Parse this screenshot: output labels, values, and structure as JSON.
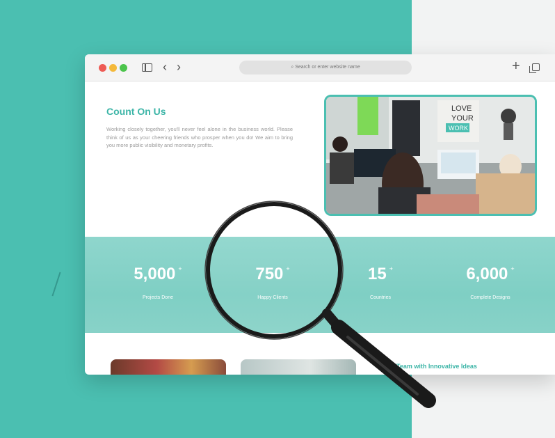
{
  "browser": {
    "address_placeholder": "Search or enter website name"
  },
  "hero": {
    "title": "Count On Us",
    "body": "Working closely together, you'll never feel alone in the business world. Please think of us as your cheering friends who prosper when you do! We aim to bring you more public visibility and monetary profits.",
    "photo_sign": [
      "LOVE",
      "YOUR",
      "WORK"
    ]
  },
  "stats": [
    {
      "value": "5,000",
      "suffix": "+",
      "label": "Projects Done"
    },
    {
      "value": "750",
      "suffix": "+",
      "label": "Happy Clients"
    },
    {
      "value": "15",
      "suffix": "+",
      "label": "Countries"
    },
    {
      "value": "6,000",
      "suffix": "+",
      "label": "Complete Designs"
    }
  ],
  "section2": {
    "heading": "d Team with Innovative Ideas"
  },
  "colors": {
    "teal": "#4bbfb1",
    "accent_text": "#3cb5a7",
    "background": "#f2f3f3"
  }
}
